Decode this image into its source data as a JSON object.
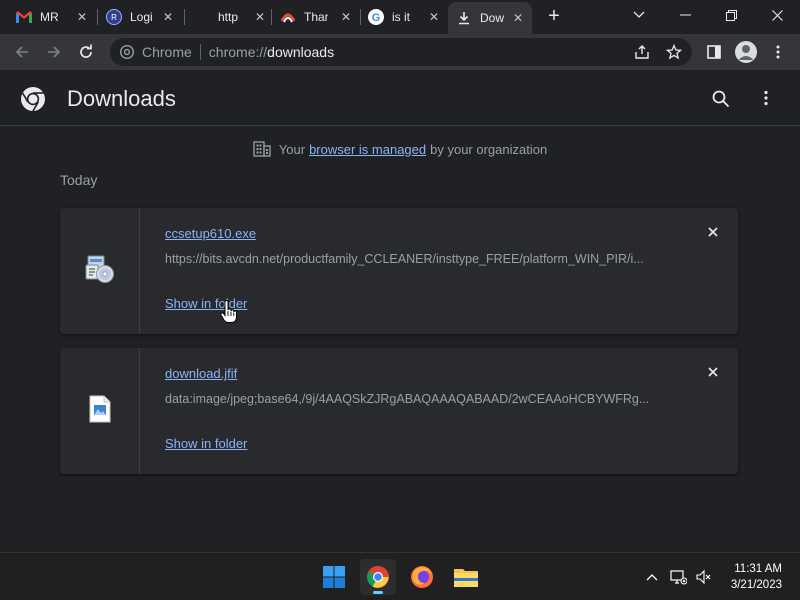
{
  "tabs": [
    {
      "title": "MR",
      "favicon": "gmail-icon"
    },
    {
      "title": "Logi",
      "favicon": "login-site-icon"
    },
    {
      "title": "http",
      "favicon": "blank-page-icon"
    },
    {
      "title": "Thar",
      "favicon": "site-icon"
    },
    {
      "title": "is it",
      "favicon": "google-icon"
    },
    {
      "title": "Dow",
      "favicon": "download-icon",
      "active": true
    }
  ],
  "toolbar": {
    "site_label": "Chrome",
    "url_prefix": "chrome://",
    "url_host": "downloads"
  },
  "header": {
    "title": "Downloads"
  },
  "managed": {
    "before": "Your",
    "link": "browser is managed",
    "after": "by your organization"
  },
  "date_heading": "Today",
  "downloads": [
    {
      "file_name": "ccsetup610.exe",
      "url": "https://bits.avcdn.net/productfamily_CCLEANER/insttype_FREE/platform_WIN_PIR/i...",
      "action": "Show in folder",
      "icon": "installer-icon"
    },
    {
      "file_name": "download.jfif",
      "url": "data:image/jpeg;base64,/9j/4AAQSkZJRgABAQAAAQABAAD/2wCEAAoHCBYWFRg...",
      "action": "Show in folder",
      "icon": "image-file-icon"
    }
  ],
  "taskbar": {
    "apps": [
      "start-icon",
      "chrome-icon",
      "firefox-icon",
      "file-explorer-icon"
    ],
    "time": "11:31 AM",
    "date": "3/21/2023"
  },
  "colors": {
    "accent_link": "#8ab4f8",
    "page_bg": "#202124",
    "card_bg": "#292a2d"
  }
}
